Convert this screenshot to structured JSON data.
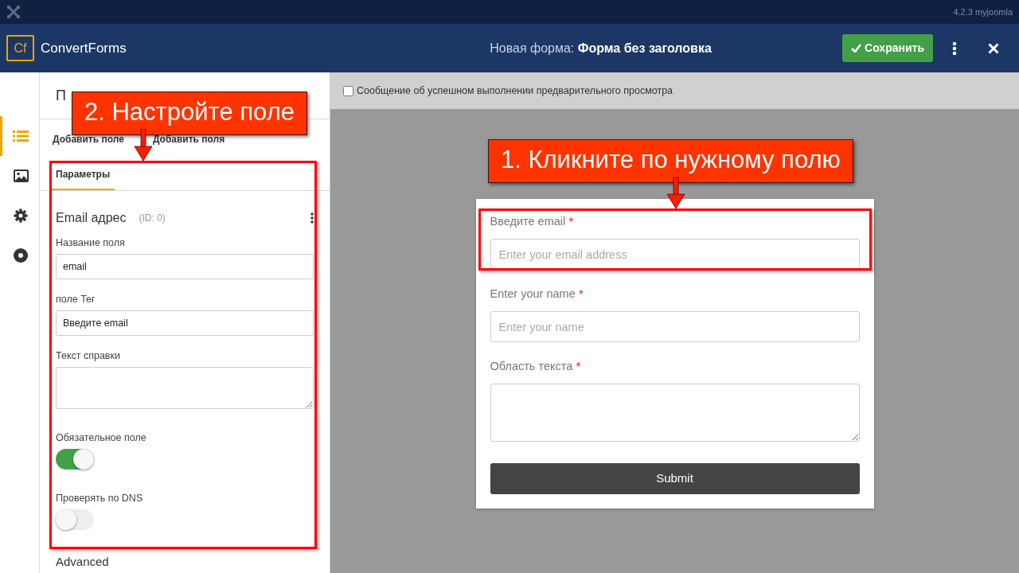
{
  "topbar": {
    "version": "4.2.3 myjoomla"
  },
  "header": {
    "logo": "Cf",
    "brand": "ConvertForms",
    "title": "Новая форма: **Форма без заголовка**",
    "save_button": "Сохранить"
  },
  "rail": [
    {
      "kind": "list",
      "selected": true
    },
    {
      "kind": "image",
      "selected": false
    },
    {
      "kind": "gear",
      "selected": false
    },
    {
      "kind": "disc",
      "selected": false
    }
  ],
  "panel": {
    "title": "П",
    "add_tabs": [
      "Добавить поле",
      "Добавить поля"
    ],
    "tabs": [
      {
        "label": "Параметры",
        "selected": true
      }
    ],
    "field_title": "Email адрес",
    "field_id": "(ID: 0)",
    "settings": [
      {
        "kind": "text",
        "label": "Название поля",
        "value": "email"
      },
      {
        "kind": "text",
        "label": "поле Тег",
        "value": "Введите email"
      },
      {
        "kind": "textarea",
        "label": "Текст справки"
      },
      {
        "kind": "toggle",
        "label": "Обязательное поле",
        "on": true
      },
      {
        "kind": "toggle",
        "label": "Проверять по DNS",
        "on": false
      }
    ],
    "next_section": "Advanced"
  },
  "preview": {
    "checkbox": {
      "label": "Сообщение об успешном выполнении предварительного просмотра",
      "checked": false
    },
    "fields": [
      {
        "kind": "input",
        "label": "Введите email",
        "required_mark": "*",
        "placeholder": "Enter your email address"
      },
      {
        "kind": "input",
        "label": "Enter your name",
        "required_mark": "*",
        "placeholder": "Enter your name"
      },
      {
        "kind": "textarea",
        "label": "Область текста",
        "required_mark": "*"
      }
    ],
    "submit": "Submit"
  },
  "annotations": [
    {
      "text": "2. Настройте поле"
    },
    {
      "text": "1. Кликните по нужному полю"
    }
  ]
}
